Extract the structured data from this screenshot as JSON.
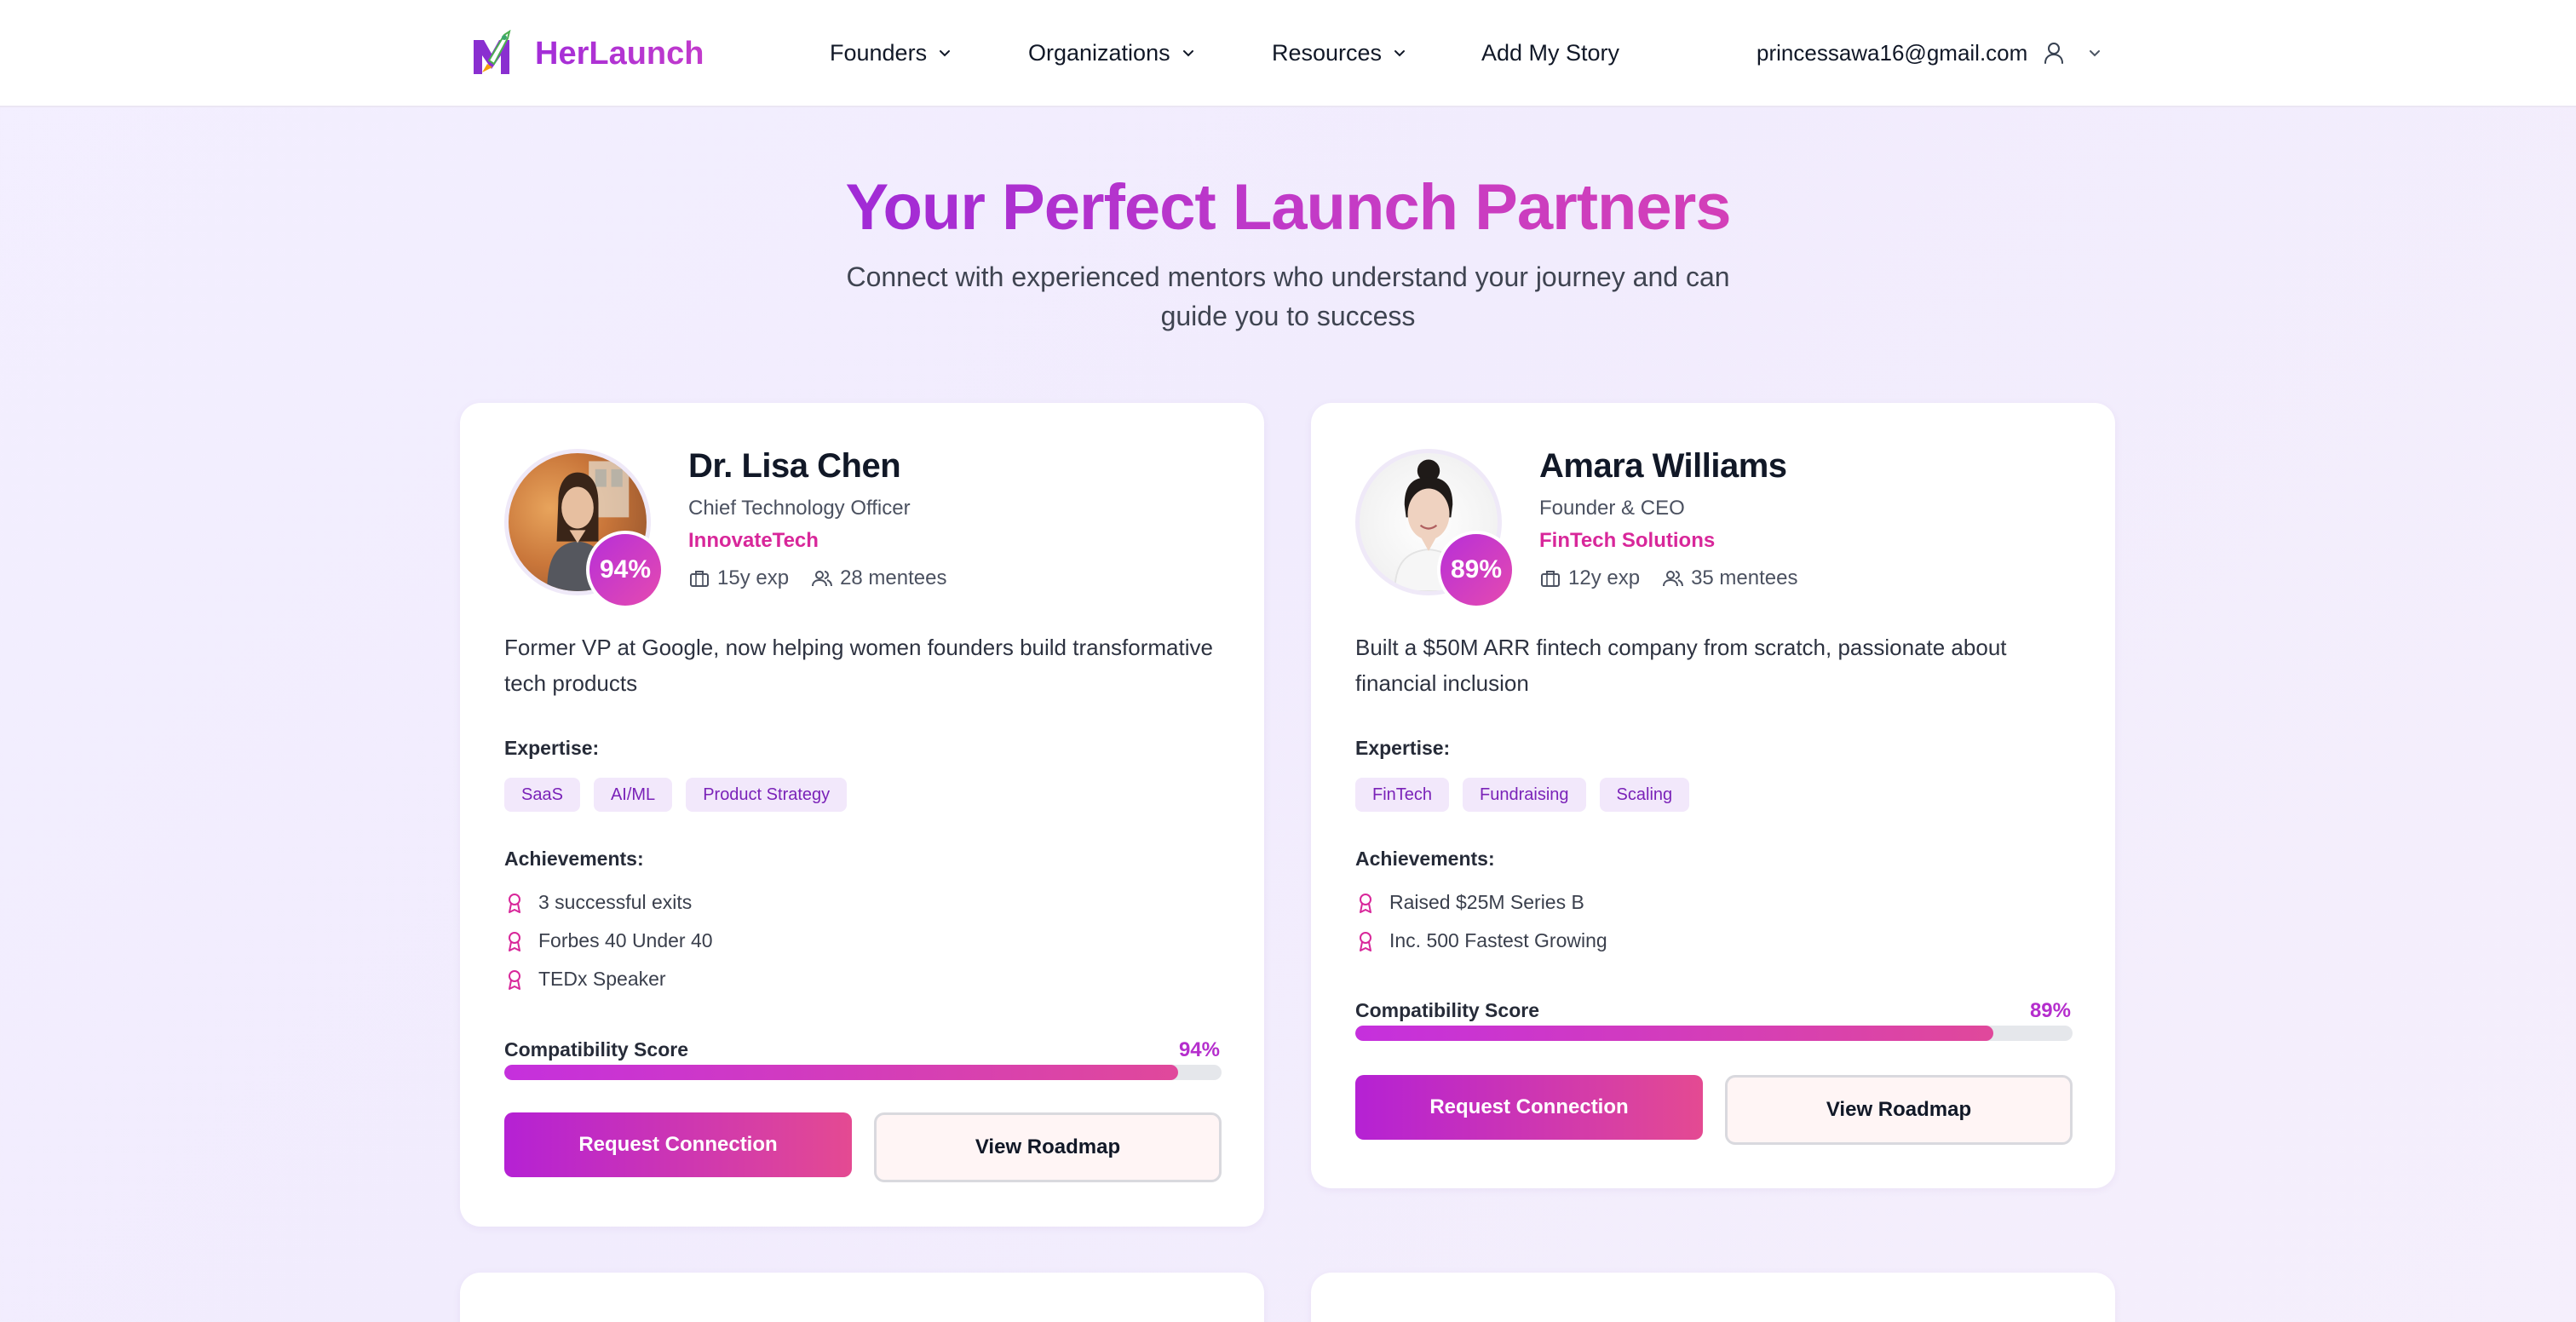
{
  "nav": {
    "brand": "HerLaunch",
    "items": [
      {
        "label": "Founders"
      },
      {
        "label": "Organizations"
      },
      {
        "label": "Resources"
      },
      {
        "label": "Add My Story"
      }
    ],
    "user_email": "princessawa16@gmail.com"
  },
  "hero": {
    "title": "Your Perfect Launch Partners",
    "subtitle": "Connect with experienced mentors who understand your journey and can guide you to success"
  },
  "labels": {
    "expertise": "Expertise:",
    "achievements": "Achievements:",
    "compatibility": "Compatibility Score",
    "request": "Request Connection",
    "roadmap": "View Roadmap"
  },
  "mentors": [
    {
      "name": "Dr. Lisa Chen",
      "role": "Chief Technology Officer",
      "company": "InnovateTech",
      "match": "94%",
      "match_value": 0.94,
      "experience": "15y exp",
      "mentees": "28 mentees",
      "bio": "Former VP at Google, now helping women founders build transformative tech products",
      "expertise": [
        "SaaS",
        "AI/ML",
        "Product Strategy"
      ],
      "achievements": [
        "3 successful exits",
        "Forbes 40 Under 40",
        "TEDx Speaker"
      ]
    },
    {
      "name": "Amara Williams",
      "role": "Founder & CEO",
      "company": "FinTech Solutions",
      "match": "89%",
      "match_value": 0.89,
      "experience": "12y exp",
      "mentees": "35 mentees",
      "bio": "Built a $50M ARR fintech company from scratch, passionate about financial inclusion",
      "expertise": [
        "FinTech",
        "Fundraising",
        "Scaling"
      ],
      "achievements": [
        "Raised $25M Series B",
        "Inc. 500 Fastest Growing"
      ]
    }
  ],
  "colors": {
    "brand_purple": "#a12ed6",
    "accent_pink": "#d8279a",
    "tag_bg": "#f2e8fb",
    "tag_text": "#7a22b8"
  }
}
